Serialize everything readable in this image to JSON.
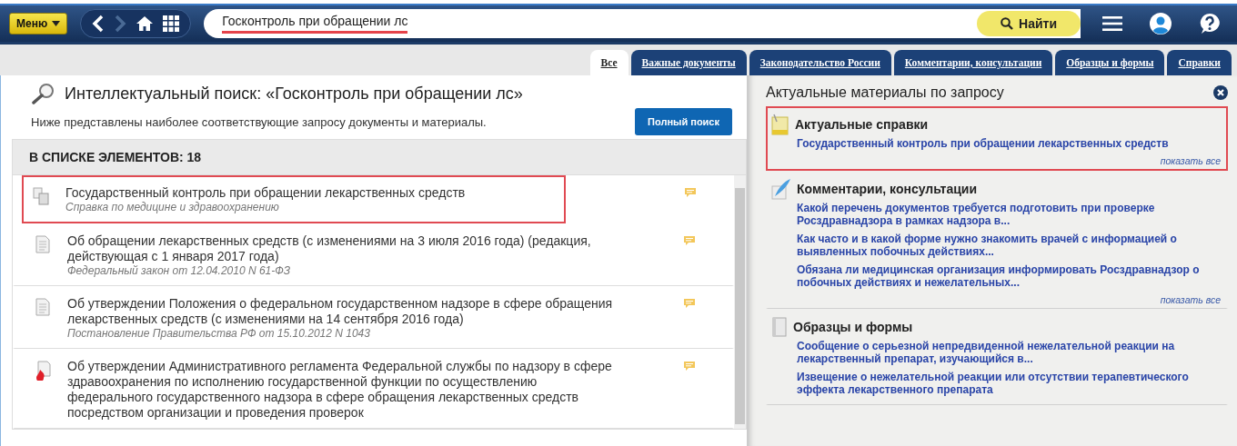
{
  "toolbar": {
    "menu_label": "Меню",
    "search_value": "Госконтроль при обращении лс",
    "search_underlined": true,
    "find_label": "Найти"
  },
  "tabs": [
    {
      "label": "Все",
      "selected": true
    },
    {
      "label": "Важные документы",
      "selected": false
    },
    {
      "label": "Законодательство России",
      "selected": false
    },
    {
      "label": "Комментарии, консультации",
      "selected": false
    },
    {
      "label": "Образцы и формы",
      "selected": false
    },
    {
      "label": "Справки",
      "selected": false
    }
  ],
  "results": {
    "title": "Интеллектуальный поиск: «Госконтроль при обращении лс»",
    "subtitle": "Ниже представлены наиболее соответствующие запросу документы и материалы.",
    "full_search_label": "Полный поиск",
    "count_label": "В СПИСКЕ ЭЛЕМЕНТОВ: 18",
    "documents": [
      {
        "kind": "reference",
        "highlighted": true,
        "title": "Государственный контроль при обращении лекарственных средств",
        "source": "Справка по медицине и здравоохранению"
      },
      {
        "kind": "document",
        "highlighted": false,
        "title": "Об обращении лекарственных средств (с изменениями на 3 июля 2016 года) (редакция, действующая с 1 января 2017 года)",
        "source": "Федеральный закон от 12.04.2010 N 61-ФЗ"
      },
      {
        "kind": "document",
        "highlighted": false,
        "title": "Об утверждении Положения о федеральном государственном надзоре в сфере обращения лекарственных средств (с изменениями на 14 сентября 2016 года)",
        "source": "Постановление Правительства РФ от 15.10.2012 N 1043"
      },
      {
        "kind": "hot",
        "highlighted": false,
        "title": "Об утверждении Административного регламента Федеральной службы по надзору в сфере здравоохранения по исполнению государственной функции по осуществлению федерального государственного надзора в сфере обращения лекарственных средств посредством организации и проведения проверок"
      }
    ]
  },
  "materials": {
    "title": "Актуальные материалы по запросу",
    "sections": [
      {
        "kind": "references",
        "highlighted": true,
        "title": "Актуальные справки",
        "links": [
          "Государственный контроль при обращении лекарственных средств"
        ],
        "show_all": "показать все"
      },
      {
        "kind": "comments",
        "highlighted": false,
        "title": "Комментарии, консультации",
        "links": [
          "Какой перечень документов требуется подготовить при проверке Росздравнадзора в рамках надзора в...",
          "Как часто и в какой форме нужно знакомить врачей с информацией о выявленных побочных действиях...",
          "Обязана ли медицинская организация информировать Росздравнадзор о побочных действиях и нежелательных..."
        ],
        "show_all": "показать все"
      },
      {
        "kind": "forms",
        "highlighted": false,
        "title": "Образцы и формы",
        "links": [
          "Сообщение о серьезной непредвиденной нежелательной реакции на лекарственный препарат, изучающийся в...",
          "Извещение о нежелательной реакции или отсутствии терапевтического эффекта лекарственного препарата"
        ]
      }
    ]
  }
}
